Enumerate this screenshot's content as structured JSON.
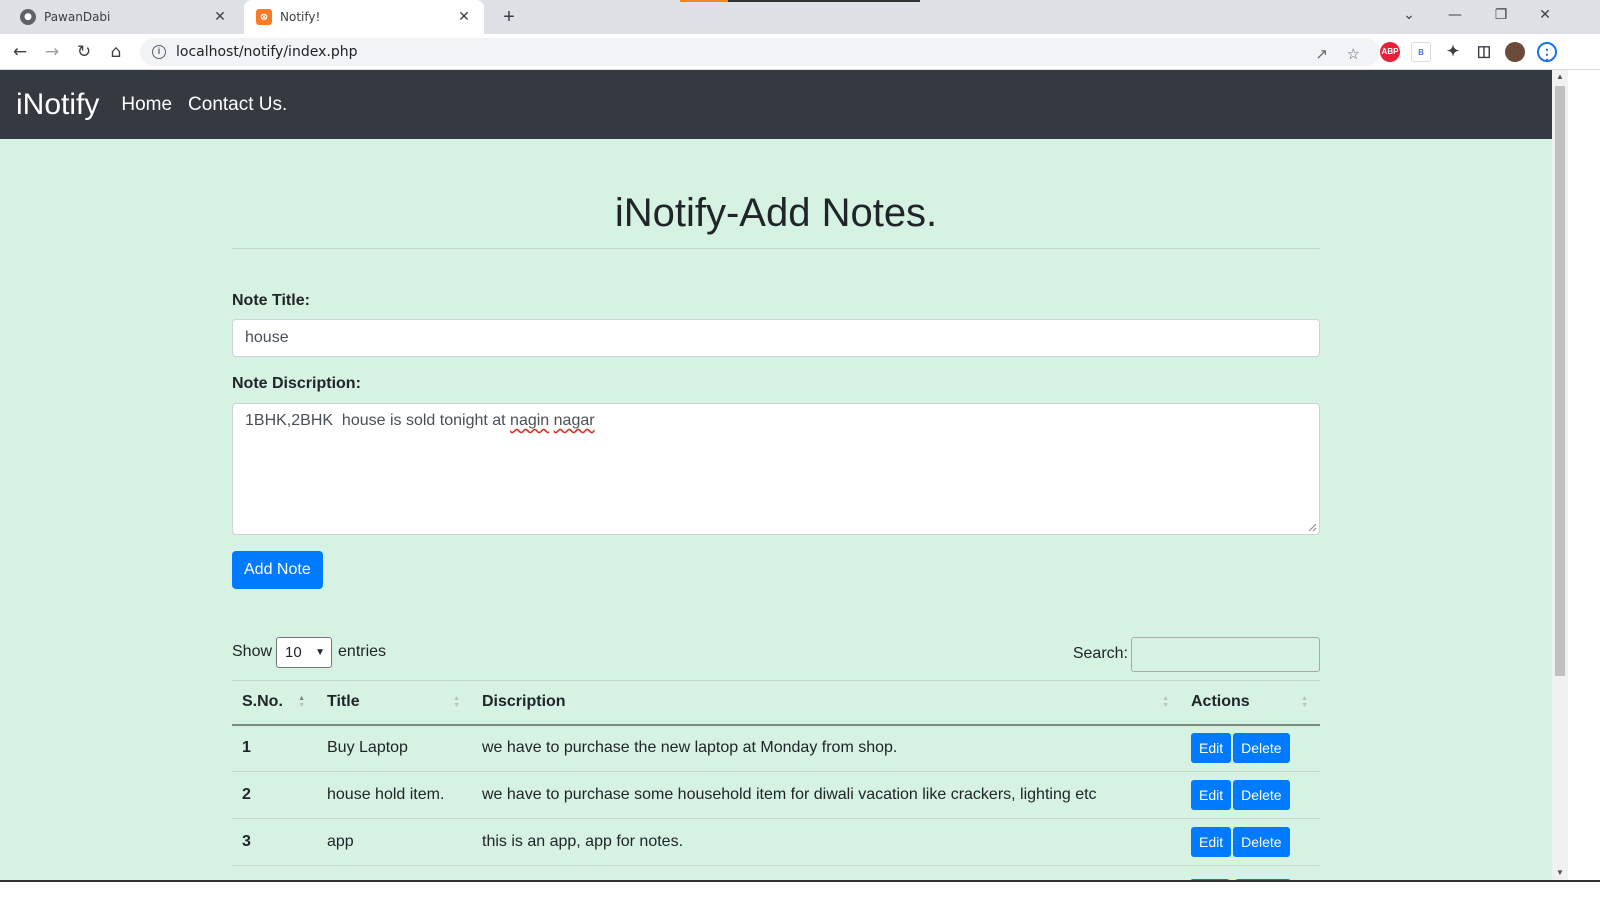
{
  "browser": {
    "tabs": [
      {
        "title": "PawanDabi",
        "icon": "github-icon",
        "active": false
      },
      {
        "title": "Notify!",
        "icon": "xampp-icon",
        "active": true
      }
    ],
    "url": "localhost/notify/index.php"
  },
  "navbar": {
    "brand": "iNotify",
    "links": [
      "Home",
      "Contact Us."
    ]
  },
  "main": {
    "heading": "iNotify-Add Notes.",
    "title_label": "Note Title:",
    "title_value": "house",
    "desc_label": "Note Discription:",
    "desc_value_plain": "1BHK,2BHK  house is sold tonight at ",
    "desc_value_word1": "nagin",
    "desc_value_word2": "nagar",
    "submit_label": "Add Note"
  },
  "datatable": {
    "show_label": "Show",
    "entries_value": "10",
    "entries_label": "entries",
    "search_label": "Search:",
    "columns": [
      "S.No.",
      "Title",
      "Discription",
      "Actions"
    ],
    "edit_label": "Edit",
    "delete_label": "Delete",
    "rows": [
      {
        "sno": "1",
        "title": "Buy Laptop",
        "desc": "we have to purchase the new laptop at Monday from shop."
      },
      {
        "sno": "2",
        "title": "house hold item.",
        "desc": "we have to purchase some household item for diwali vacation like crackers, lighting etc"
      },
      {
        "sno": "3",
        "title": "app",
        "desc": "this is an app, app for notes."
      }
    ]
  },
  "colors": {
    "page_bg": "#d6f2e2",
    "navbar_bg": "#343a40",
    "primary": "#007bff"
  }
}
